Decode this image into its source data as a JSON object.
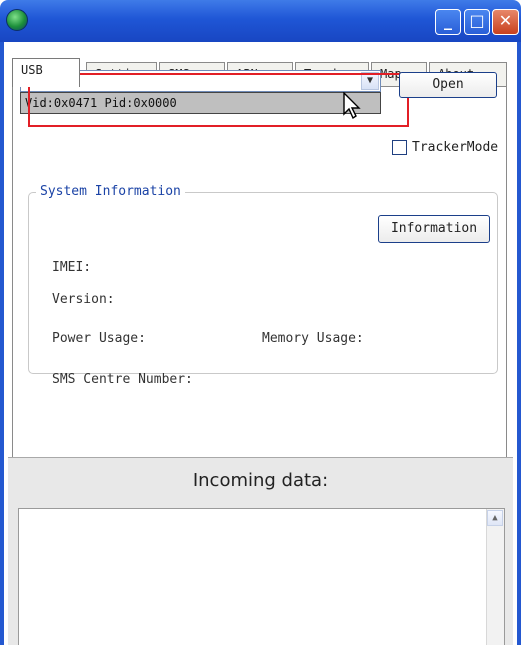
{
  "title_bar": {
    "icon": "app-globe-icon",
    "buttons": {
      "minimize_glyph": "_",
      "maximize_glyph": "□",
      "close_glyph": "✕"
    }
  },
  "tabs": [
    {
      "label": "USB",
      "active": true
    },
    {
      "label": "Setting",
      "active": false
    },
    {
      "label": "SMS",
      "active": false
    },
    {
      "label": "APN",
      "active": false
    },
    {
      "label": "Tracker",
      "active": false
    },
    {
      "label": "Map",
      "active": false
    },
    {
      "label": "About",
      "active": false
    }
  ],
  "usb": {
    "device_combo": {
      "value": "",
      "dropdown_items": [
        "Vid:0x0471 Pid:0x0000"
      ]
    },
    "open_button_label": "Open",
    "tracker_mode_label": "TrackerMode",
    "tracker_mode_checked": false
  },
  "system_information": {
    "title": "System Information",
    "imei_label": "IMEI:",
    "version_label": "Version:",
    "power_usage_label": "Power Usage:",
    "memory_usage_label": "Memory Usage:",
    "sms_centre_label": "SMS Centre Number:",
    "information_button_label": "Information"
  },
  "incoming": {
    "title": "Incoming data:",
    "content": ""
  },
  "colors": {
    "titlebar": "#2458d0",
    "highlight": "#e21f26",
    "group_title": "#1b43a6"
  }
}
